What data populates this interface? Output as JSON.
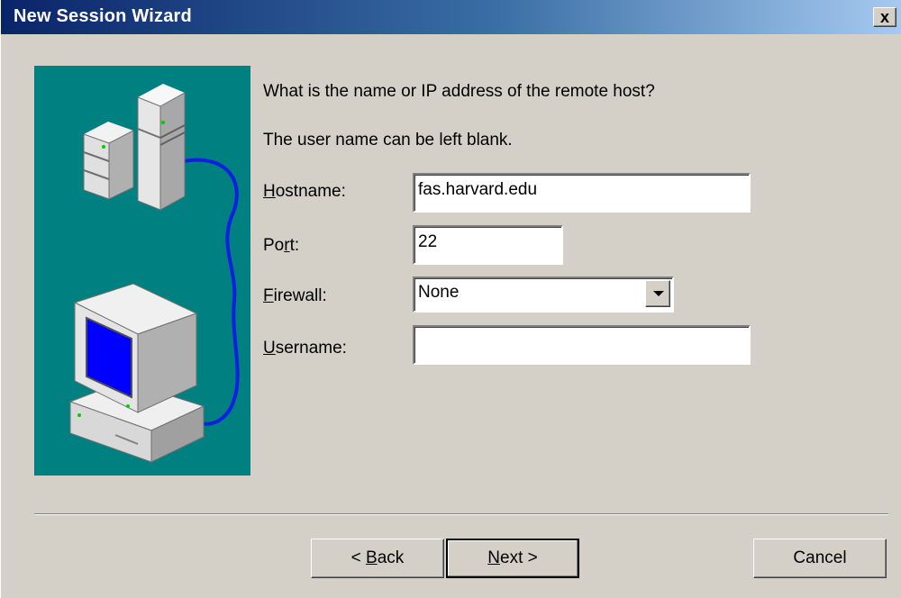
{
  "window": {
    "title": "New Session Wizard",
    "close_glyph": "x"
  },
  "colors": {
    "titlebar_start": "#0a246a",
    "titlebar_end": "#a6caf0",
    "illustration_bg": "#008080",
    "screen_blue": "#0000ff",
    "cable_blue": "#1020e0"
  },
  "illustration": {
    "icon_names": [
      "server-tower-icon",
      "computer-monitor-icon",
      "network-cable-icon"
    ]
  },
  "prompt": {
    "question": "What is the name or IP address of the remote host?",
    "hint": "The user name can be left blank."
  },
  "form": {
    "hostname": {
      "mnemonic": "H",
      "rest": "ostname:",
      "value": "fas.harvard.edu"
    },
    "port": {
      "before": "Po",
      "mnemonic": "r",
      "rest": "t:",
      "value": "22"
    },
    "firewall": {
      "mnemonic": "F",
      "rest": "irewall:",
      "selected": "None"
    },
    "username": {
      "mnemonic": "U",
      "rest": "sername:",
      "value": ""
    }
  },
  "buttons": {
    "back": {
      "prefix": "< ",
      "mnemonic": "B",
      "rest": "ack"
    },
    "next": {
      "mnemonic": "N",
      "rest": "ext >"
    },
    "cancel": "Cancel"
  }
}
